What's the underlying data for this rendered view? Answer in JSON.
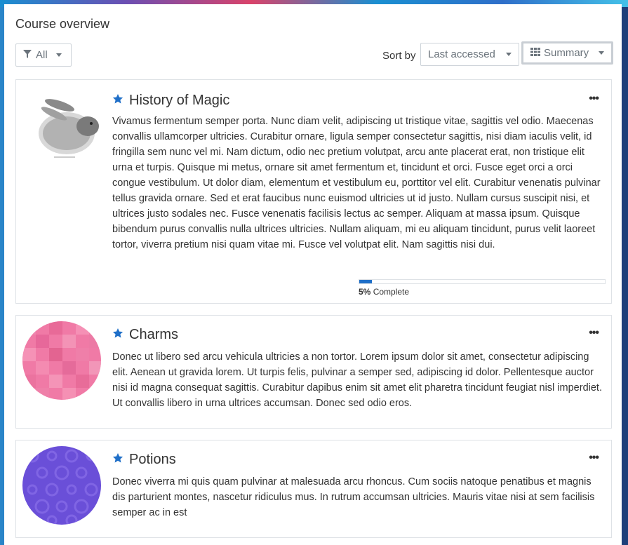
{
  "block": {
    "title": "Course overview"
  },
  "filter": {
    "label": "All"
  },
  "sort": {
    "prefix": "Sort by",
    "value": "Last accessed"
  },
  "view": {
    "label": "Summary"
  },
  "courses": [
    {
      "name": "History of Magic",
      "description": "Vivamus fermentum semper porta. Nunc diam velit, adipiscing ut tristique vitae, sagittis vel odio. Maecenas convallis ullamcorper ultricies. Curabitur ornare, ligula semper consectetur sagittis, nisi diam iaculis velit, id fringilla sem nunc vel mi. Nam dictum, odio nec pretium volutpat, arcu ante placerat erat, non tristique elit urna et turpis. Quisque mi metus, ornare sit amet fermentum et, tincidunt et orci. Fusce eget orci a orci congue vestibulum. Ut dolor diam, elementum et vestibulum eu, porttitor vel elit. Curabitur venenatis pulvinar tellus gravida ornare. Sed et erat faucibus nunc euismod ultricies ut id justo. Nullam cursus suscipit nisi, et ultrices justo sodales nec. Fusce venenatis facilisis lectus ac semper. Aliquam at massa ipsum. Quisque bibendum purus convallis nulla ultrices ultricies. Nullam aliquam, mi eu aliquam tincidunt, purus velit laoreet tortor, viverra pretium nisi quam vitae mi. Fusce vel volutpat elit. Nam sagittis nisi dui.",
      "progress_percent": 5,
      "progress_value": "5%",
      "progress_suffix": "Complete",
      "starred": true
    },
    {
      "name": "Charms",
      "description": "Donec ut libero sed arcu vehicula ultricies a non tortor. Lorem ipsum dolor sit amet, consectetur adipiscing elit. Aenean ut gravida lorem. Ut turpis felis, pulvinar a semper sed, adipiscing id dolor. Pellentesque auctor nisi id magna consequat sagittis. Curabitur dapibus enim sit amet elit pharetra tincidunt feugiat nisl imperdiet. Ut convallis libero in urna ultrices accumsan. Donec sed odio eros.",
      "starred": true,
      "thumb_color": "#f07aa6"
    },
    {
      "name": "Potions",
      "description": "Donec viverra mi quis quam pulvinar at malesuada arcu rhoncus. Cum sociis natoque penatibus et magnis dis parturient montes, nascetur ridiculus mus. In rutrum accumsan ultricies. Mauris vitae nisi at sem facilisis semper ac in est",
      "starred": true,
      "thumb_color": "#6a4fd8"
    }
  ],
  "colors": {
    "star": "#1f6fc8",
    "accent": "#1f6fc8"
  },
  "icons": {
    "filter": "filter-icon",
    "grid": "grid-icon",
    "star": "star-icon",
    "more": "more-icon"
  }
}
